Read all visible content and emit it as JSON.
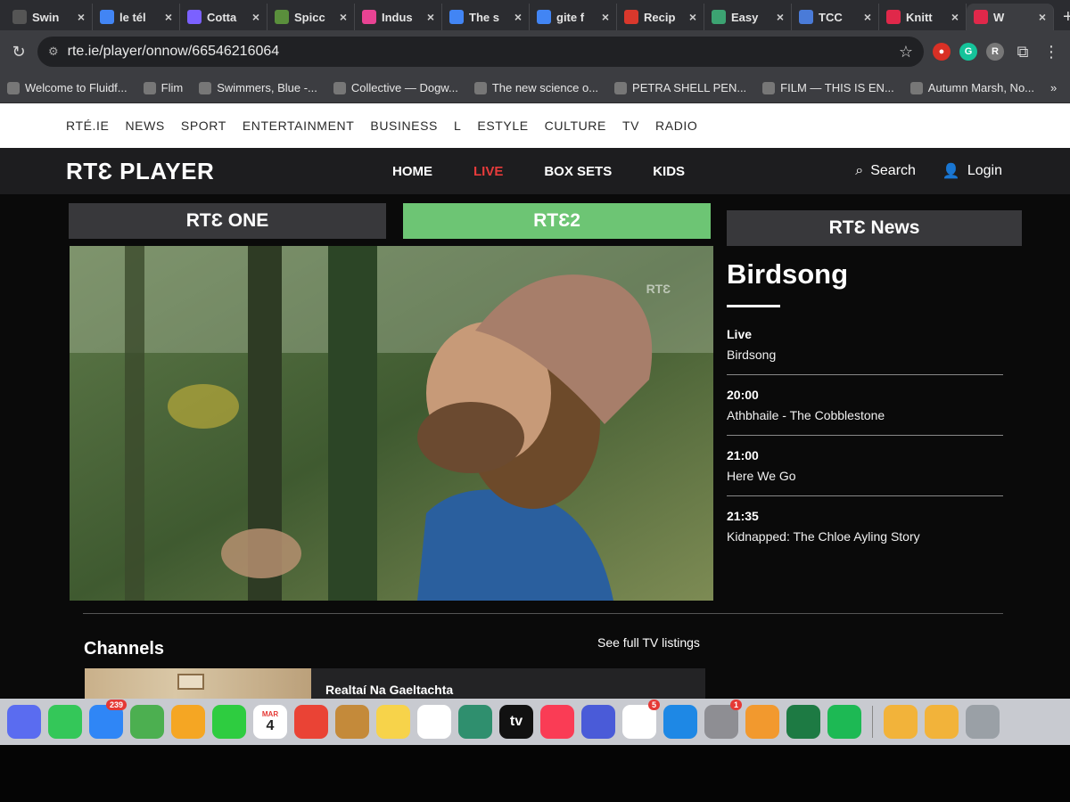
{
  "browser": {
    "tabs": [
      {
        "label": "Swin",
        "color": "#555555"
      },
      {
        "label": "le tél",
        "color": "#4285f4"
      },
      {
        "label": "Cotta",
        "color": "#7b61ff"
      },
      {
        "label": "Spicc",
        "color": "#5a8f3c"
      },
      {
        "label": "Indus",
        "color": "#e84393"
      },
      {
        "label": "The s",
        "color": "#4285f4"
      },
      {
        "label": "gite f",
        "color": "#4285f4"
      },
      {
        "label": "Recip",
        "color": "#d9382c"
      },
      {
        "label": "Easy",
        "color": "#3ca372"
      },
      {
        "label": "TCC",
        "color": "#4a7bd8"
      },
      {
        "label": "Knitt",
        "color": "#e0284a"
      },
      {
        "label": "W",
        "color": "#e0284a"
      }
    ],
    "url": "rte.ie/player/onnow/66546216064",
    "bookmarks": [
      "Welcome to Fluidf...",
      "Flim",
      "Swimmers, Blue -...",
      "Collective — Dogw...",
      "The new science o...",
      "PETRA SHELL PEN...",
      "FILM — THIS IS EN...",
      "Autumn Marsh, No..."
    ],
    "bookmarks_more": "»"
  },
  "rte_nav": {
    "items": [
      "RTÉ.IE",
      "NEWS",
      "SPORT",
      "ENTERTAINMENT",
      "BUSINESS",
      "L",
      "ESTYLE",
      "CULTURE",
      "TV",
      "RADIO"
    ]
  },
  "player": {
    "logo": "RTƐ PLAYER",
    "nav": [
      "HOME",
      "LIVE",
      "BOX SETS",
      "KIDS"
    ],
    "active_nav": "LIVE",
    "live_color": "#e63b3b",
    "search": "Search",
    "login": "Login"
  },
  "channels_tabs": {
    "one": "RTƐ ONE",
    "two": "RTƐ2",
    "news": "RTƐ News",
    "active": "two",
    "active_color": "#6dc574"
  },
  "video": {
    "watermark": "RTƐ"
  },
  "schedule": {
    "title": "Birdsong",
    "items": [
      {
        "time": "Live",
        "name": "Birdsong"
      },
      {
        "time": "20:00",
        "name": "Athbhaile - The Cobblestone"
      },
      {
        "time": "21:00",
        "name": "Here We Go"
      },
      {
        "time": "21:35",
        "name": "Kidnapped: The Chloe Ayling Story"
      }
    ]
  },
  "channels_section": {
    "heading": "Channels",
    "listings_link": "See full TV listings",
    "first_channel": "Realtaí Na Gaeltachta"
  },
  "dock": {
    "items": [
      {
        "icon": "launchpad-icon",
        "color": "#5a6cf0",
        "badge": ""
      },
      {
        "icon": "messages-icon",
        "color": "#34c759",
        "badge": ""
      },
      {
        "icon": "mail-icon",
        "color": "#2f86f6",
        "badge": "239"
      },
      {
        "icon": "maps-icon",
        "color": "#4caf50",
        "badge": ""
      },
      {
        "icon": "photos-icon",
        "color": "#f5a623",
        "badge": ""
      },
      {
        "icon": "facetime-icon",
        "color": "#2ecc40",
        "badge": ""
      },
      {
        "icon": "calendar-icon",
        "color": "#ffffff",
        "badge": "",
        "month": "MAR",
        "day": "4"
      },
      {
        "icon": "chrome-icon",
        "color": "#ea4335",
        "badge": ""
      },
      {
        "icon": "contacts-icon",
        "color": "#c48a3a",
        "badge": ""
      },
      {
        "icon": "notes-icon",
        "color": "#f7d34a",
        "badge": ""
      },
      {
        "icon": "freeform-icon",
        "color": "#ffffff",
        "badge": ""
      },
      {
        "icon": "scrivener-icon",
        "color": "#2f8f6e",
        "badge": ""
      },
      {
        "icon": "appletv-icon",
        "color": "#111111",
        "badge": "",
        "text": "tv"
      },
      {
        "icon": "music-icon",
        "color": "#fa3c55",
        "badge": ""
      },
      {
        "icon": "shortcuts-icon",
        "color": "#4a5bd8",
        "badge": ""
      },
      {
        "icon": "reminders-icon",
        "color": "#ffffff",
        "badge": "5"
      },
      {
        "icon": "appstore-icon",
        "color": "#1e88e5",
        "badge": ""
      },
      {
        "icon": "settings-icon",
        "color": "#8e8e93",
        "badge": "1"
      },
      {
        "icon": "pages-icon",
        "color": "#f2992e",
        "badge": ""
      },
      {
        "icon": "excel-icon",
        "color": "#1d7a43",
        "badge": ""
      },
      {
        "icon": "spotify-icon",
        "color": "#1db954",
        "badge": ""
      },
      {
        "icon": "folder-icon",
        "color": "#f2b33a",
        "badge": ""
      },
      {
        "icon": "folder-icon",
        "color": "#f2b33a",
        "badge": ""
      },
      {
        "icon": "trash-icon",
        "color": "#9aa0a6",
        "badge": ""
      }
    ]
  }
}
